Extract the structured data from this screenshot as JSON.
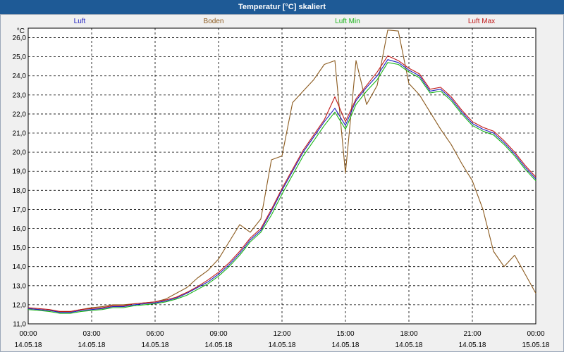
{
  "window": {
    "title": "Temperatur [°C] skaliert"
  },
  "colors": {
    "title_bar": "#1e5a96",
    "luft": "#2020c0",
    "boden": "#8b5a1e",
    "luft_min": "#18b418",
    "luft_max": "#c01818"
  },
  "chart_data": {
    "type": "line",
    "title": "Temperatur [°C] skaliert",
    "ylabel": "°C",
    "xlabel": "",
    "ylim": [
      11.0,
      26.5
    ],
    "xlim_hours": [
      0,
      24
    ],
    "grid": true,
    "legend_position": "top",
    "y_ticks": [
      "11,0",
      "12,0",
      "13,0",
      "14,0",
      "15,0",
      "16,0",
      "17,0",
      "18,0",
      "19,0",
      "20,0",
      "21,0",
      "22,0",
      "23,0",
      "24,0",
      "25,0",
      "26,0"
    ],
    "x_ticks": [
      {
        "time": "00:00",
        "date": "14.05.18"
      },
      {
        "time": "03:00",
        "date": "14.05.18"
      },
      {
        "time": "06:00",
        "date": "14.05.18"
      },
      {
        "time": "09:00",
        "date": "14.05.18"
      },
      {
        "time": "12:00",
        "date": "14.05.18"
      },
      {
        "time": "15:00",
        "date": "14.05.18"
      },
      {
        "time": "18:00",
        "date": "14.05.18"
      },
      {
        "time": "21:00",
        "date": "14.05.18"
      },
      {
        "time": "00:00",
        "date": "15.05.18"
      }
    ],
    "x_hours": [
      0,
      0.5,
      1,
      1.5,
      2,
      2.5,
      3,
      3.5,
      4,
      4.5,
      5,
      5.5,
      6,
      6.5,
      7,
      7.5,
      8,
      8.5,
      9,
      9.5,
      10,
      10.5,
      11,
      11.5,
      12,
      12.5,
      13,
      13.5,
      14,
      14.5,
      15,
      15.5,
      16,
      16.5,
      17,
      17.5,
      18,
      18.5,
      19,
      19.5,
      20,
      20.5,
      21,
      21.5,
      22,
      22.5,
      23,
      23.5,
      24
    ],
    "series": [
      {
        "name": "Luft",
        "color": "#2020c0",
        "values": [
          11.8,
          11.75,
          11.7,
          11.6,
          11.6,
          11.7,
          11.75,
          11.8,
          11.9,
          11.9,
          12.0,
          12.05,
          12.1,
          12.2,
          12.35,
          12.6,
          12.9,
          13.2,
          13.6,
          14.1,
          14.7,
          15.4,
          15.9,
          16.9,
          18.0,
          19.0,
          20.0,
          20.8,
          21.6,
          22.3,
          21.4,
          22.7,
          23.4,
          24.0,
          24.85,
          24.7,
          24.3,
          24.0,
          23.2,
          23.3,
          22.8,
          22.1,
          21.5,
          21.2,
          21.0,
          20.5,
          19.9,
          19.2,
          18.6
        ]
      },
      {
        "name": "Boden",
        "color": "#8b5a1e",
        "values": [
          11.8,
          11.75,
          11.7,
          11.65,
          11.65,
          11.75,
          11.85,
          11.9,
          12.0,
          12.0,
          12.05,
          12.1,
          12.15,
          12.3,
          12.6,
          12.9,
          13.4,
          13.8,
          14.4,
          15.3,
          16.2,
          15.8,
          16.5,
          19.6,
          19.8,
          22.6,
          23.2,
          23.8,
          24.6,
          24.8,
          18.9,
          24.8,
          22.5,
          23.5,
          26.4,
          26.35,
          23.6,
          23.0,
          22.1,
          21.2,
          20.4,
          19.4,
          18.5,
          17.0,
          14.8,
          14.0,
          14.6,
          13.6,
          12.6
        ]
      },
      {
        "name": "Luft Min",
        "color": "#18b418",
        "values": [
          11.75,
          11.7,
          11.65,
          11.55,
          11.55,
          11.65,
          11.7,
          11.75,
          11.85,
          11.85,
          11.95,
          12.0,
          12.05,
          12.15,
          12.3,
          12.5,
          12.8,
          13.1,
          13.5,
          14.0,
          14.6,
          15.3,
          15.8,
          16.7,
          17.8,
          18.8,
          19.8,
          20.6,
          21.4,
          22.1,
          21.2,
          22.5,
          23.2,
          23.8,
          24.7,
          24.6,
          24.2,
          23.9,
          23.1,
          23.2,
          22.7,
          22.0,
          21.4,
          21.1,
          20.9,
          20.4,
          19.8,
          19.1,
          18.5
        ]
      },
      {
        "name": "Luft Max",
        "color": "#c01818",
        "values": [
          11.85,
          11.8,
          11.75,
          11.65,
          11.65,
          11.75,
          11.8,
          11.85,
          11.95,
          11.95,
          12.05,
          12.1,
          12.15,
          12.25,
          12.4,
          12.65,
          12.95,
          13.3,
          13.7,
          14.2,
          14.8,
          15.5,
          16.0,
          17.0,
          18.1,
          19.1,
          20.1,
          20.9,
          21.7,
          22.9,
          21.6,
          22.8,
          23.5,
          24.2,
          25.05,
          24.8,
          24.4,
          24.1,
          23.3,
          23.4,
          22.9,
          22.2,
          21.6,
          21.3,
          21.1,
          20.6,
          20.0,
          19.3,
          18.7
        ]
      }
    ]
  }
}
